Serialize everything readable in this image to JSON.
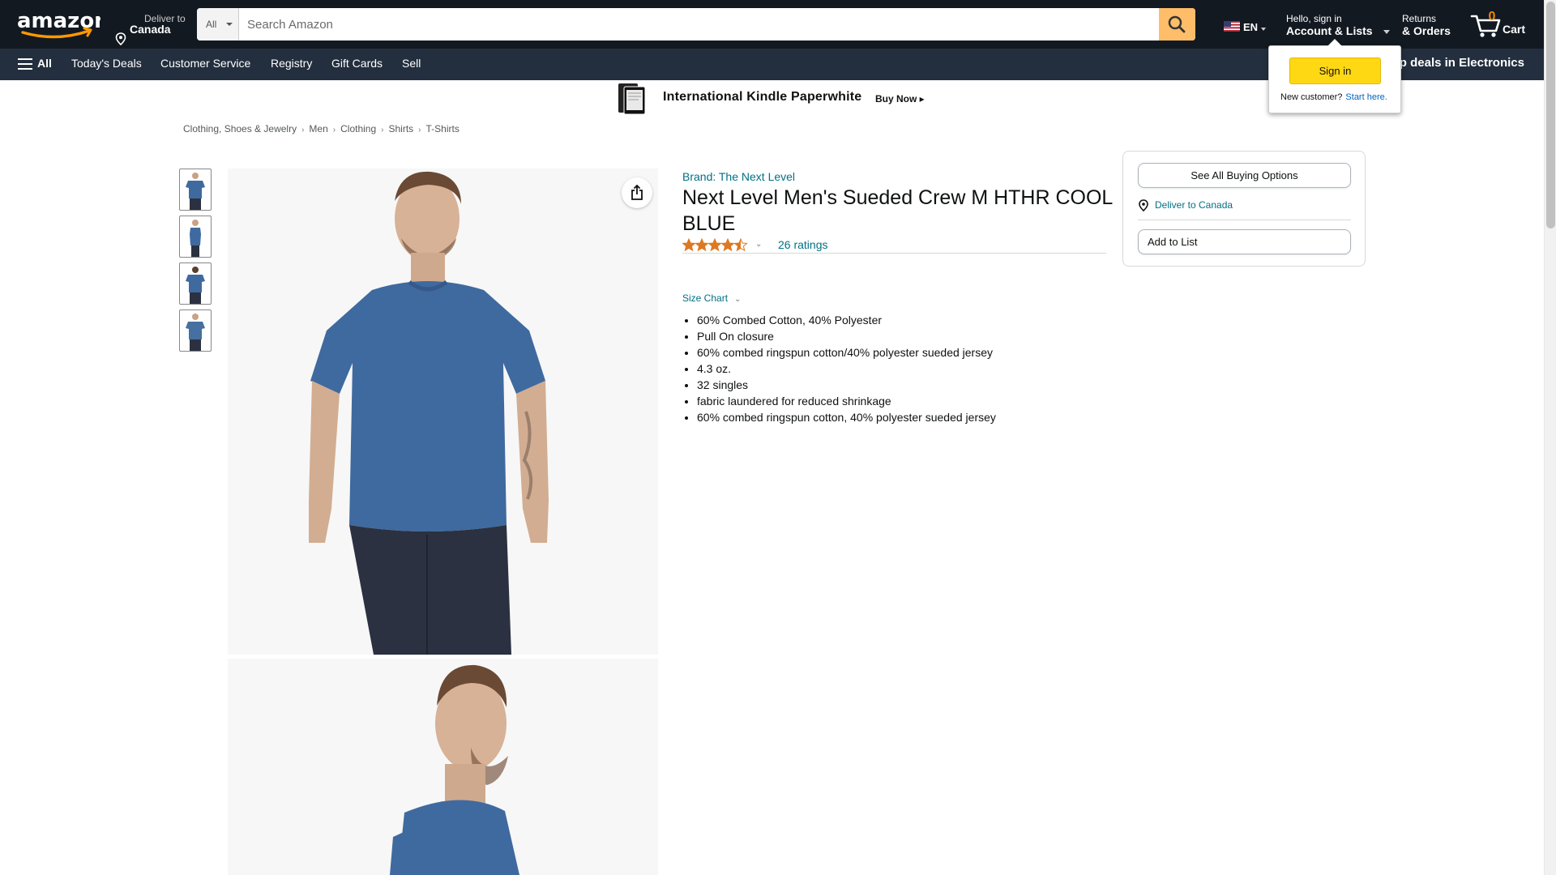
{
  "header": {
    "logo_text": "amazon",
    "deliver_line1": "Deliver to",
    "deliver_line2": "Canada",
    "search": {
      "category": "All",
      "placeholder": "Search Amazon",
      "value": ""
    },
    "language": "EN",
    "account_line1": "Hello, sign in",
    "account_line2": "Account & Lists",
    "returns_line1": "Returns",
    "returns_line2": "& Orders",
    "cart_count": "0",
    "cart_label": "Cart"
  },
  "subnav": {
    "all_label": "All",
    "items": [
      "Today's Deals",
      "Customer Service",
      "Registry",
      "Gift Cards",
      "Sell"
    ],
    "promo": "Shop deals in Electronics"
  },
  "banner": {
    "text": "International Kindle Paperwhite",
    "cta": "Buy Now ▸"
  },
  "breadcrumb": [
    "Clothing, Shoes & Jewelry",
    "Men",
    "Clothing",
    "Shirts",
    "T-Shirts"
  ],
  "product": {
    "brand": "Brand: The Next Level",
    "title": "Next Level Men's Sueded Crew M HTHR COOL BLUE",
    "rating_value": 4.5,
    "ratings_count": "26 ratings",
    "size_chart": "Size Chart",
    "bullets": [
      "60% Combed Cotton, 40% Polyester",
      "Pull On closure",
      "60% combed ringspun cotton/40% polyester sueded jersey",
      "4.3 oz.",
      "32 singles",
      "fabric laundered for reduced shrinkage",
      "60% combed ringspun cotton, 40% polyester sueded jersey"
    ],
    "shirt_color": "#3f6a9f"
  },
  "buybox": {
    "see_all": "See All Buying Options",
    "deliver": "Deliver to Canada",
    "add_to_list": "Add to List"
  },
  "flyout": {
    "signin": "Sign in",
    "new_customer": "New customer?",
    "start_here": "Start here."
  },
  "colors": {
    "nav_dark": "#131921",
    "nav_sub": "#232f3e",
    "search_button": "#febd69",
    "link": "#007185",
    "star": "#de7921",
    "signin_button": "#ffd814"
  }
}
